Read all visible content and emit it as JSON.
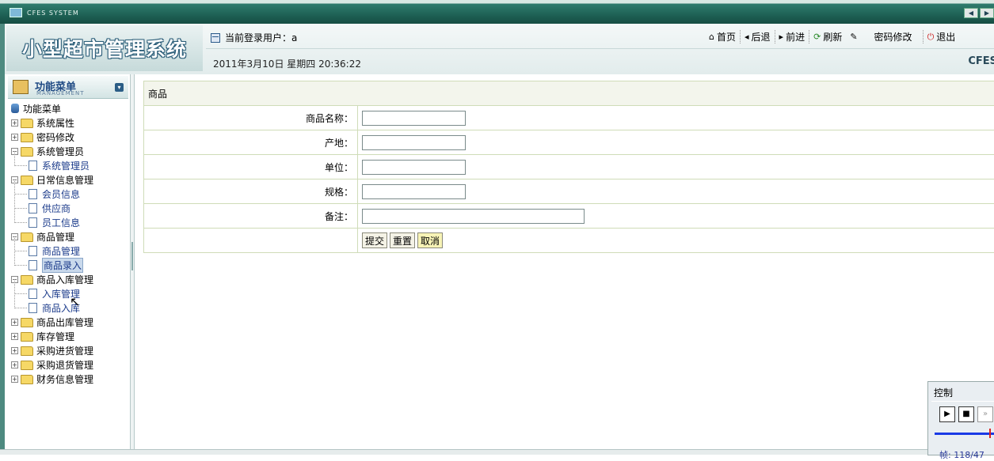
{
  "window": {
    "title": "CFES SYSTEM"
  },
  "header": {
    "app_title": "小型超市管理系统",
    "user_label": "当前登录用户：a",
    "datetime": "2011年3月10日  星期四  20:36:22",
    "brand_corner": "CFES",
    "toolbar": {
      "home": "首页",
      "back": "后退",
      "forward": "前进",
      "refresh": "刷新",
      "password": "密码修改",
      "logout": "退出"
    }
  },
  "sidebar": {
    "menu_title": "功能菜单",
    "menu_subtitle": "MANAGEMENT",
    "root": "功能菜单",
    "items": [
      {
        "label": "系统属性"
      },
      {
        "label": "密码修改"
      },
      {
        "label": "系统管理员",
        "children": [
          "系统管理员"
        ]
      },
      {
        "label": "日常信息管理",
        "children": [
          "会员信息",
          "供应商",
          "员工信息"
        ]
      },
      {
        "label": "商品管理",
        "children": [
          "商品管理",
          "商品录入"
        ]
      },
      {
        "label": "商品入库管理",
        "children": [
          "入库管理",
          "商品入库"
        ]
      },
      {
        "label": "商品出库管理"
      },
      {
        "label": "库存管理"
      },
      {
        "label": "采购进货管理"
      },
      {
        "label": "采购退货管理"
      },
      {
        "label": "财务信息管理"
      }
    ]
  },
  "form": {
    "title": "商品",
    "fields": {
      "name": {
        "label": "商品名称：",
        "value": ""
      },
      "origin": {
        "label": "产地：",
        "value": ""
      },
      "unit": {
        "label": "单位：",
        "value": ""
      },
      "spec": {
        "label": "规格：",
        "value": ""
      },
      "note": {
        "label": "备注：",
        "value": ""
      }
    },
    "buttons": {
      "submit": "提交",
      "reset": "重置",
      "cancel": "取消"
    }
  },
  "control_panel": {
    "title": "控制",
    "frame_text": "帧: 118/47"
  },
  "colors": {
    "header_green": "#1d5f53",
    "form_border": "#cfdcb8",
    "menu_title_blue": "#1f4a84"
  }
}
